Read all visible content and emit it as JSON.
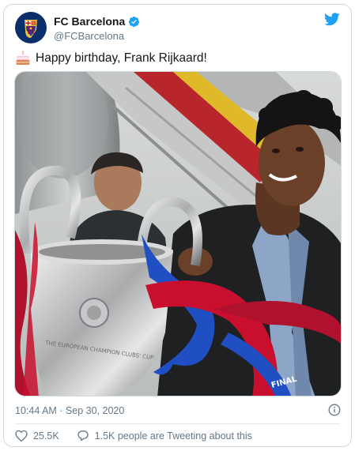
{
  "account": {
    "name": "FC Barcelona",
    "handle": "@FCBarcelona"
  },
  "tweet": {
    "emoji_icon": "birthday-cake-icon",
    "text": "Happy birthday, Frank Rijkaard!"
  },
  "media": {
    "trophy_engraving": "THE EUROPEAN CHAMPION CLUBS' CUP",
    "shirt_text": "FINAL"
  },
  "meta": {
    "timestamp": "10:44 AM · Sep 30, 2020"
  },
  "actions": {
    "likes": "25.5K",
    "retweet_text": "1.5K people are Tweeting about this"
  },
  "colors": {
    "accent": "#1da1f2",
    "muted": "#657786",
    "heart": "#657786"
  }
}
